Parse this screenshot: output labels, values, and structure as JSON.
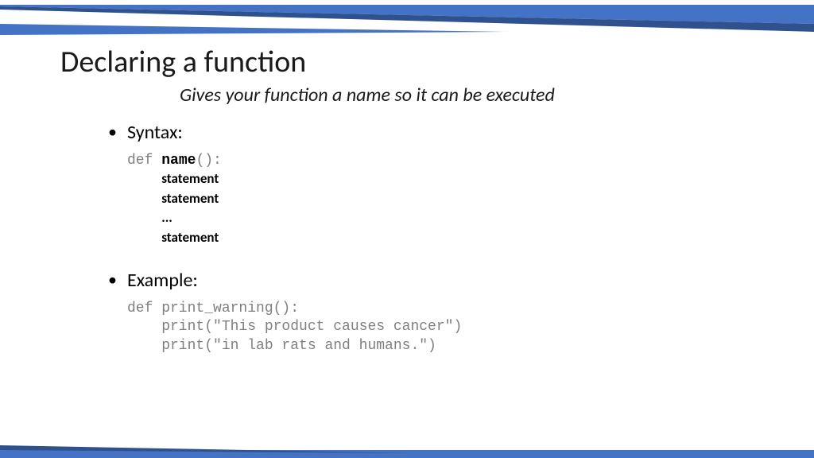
{
  "title": "Declaring a function",
  "subtitle": "Gives your function a name so it can be executed",
  "bullets": {
    "syntax": {
      "label": "Syntax:",
      "def_kw": "def ",
      "name_part": "name",
      "paren_colon": "():",
      "indent": "    ",
      "stmt1": "statement",
      "stmt2": "statement",
      "dots": "...",
      "stmt3": "statement"
    },
    "example": {
      "label": "Example:",
      "line1": "def print_warning():",
      "line2": "    print(\"This product causes cancer\")",
      "line3": "    print(\"in lab rats and humans.\")"
    }
  },
  "colors": {
    "accent": "#4472C4",
    "accent_dark": "#3B5998"
  }
}
